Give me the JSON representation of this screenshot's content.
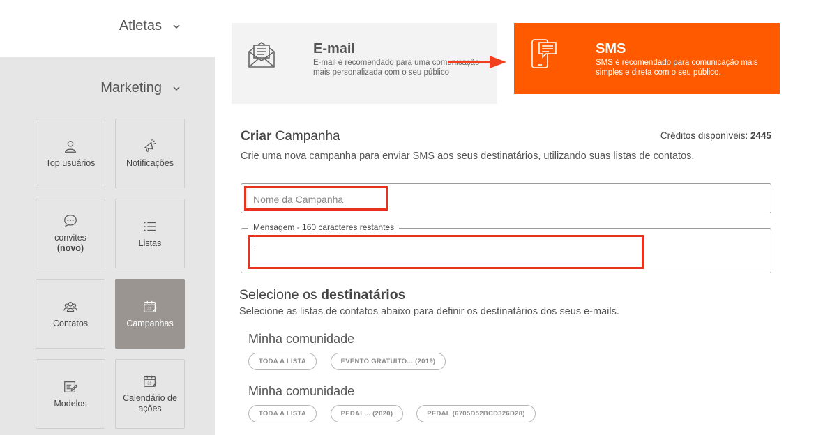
{
  "sidebar": {
    "athletes_label": "Atletas",
    "marketing_label": "Marketing",
    "tiles": {
      "top_users": "Top usuários",
      "notifications": "Notificações",
      "invites": "convites",
      "invites_badge": "(novo)",
      "lists": "Listas",
      "contacts": "Contatos",
      "campaigns": "Campanhas",
      "templates": "Modelos",
      "calendar_line1": "Calendário de",
      "calendar_line2": "ações"
    },
    "active_tile": "campaigns"
  },
  "channels": {
    "email": {
      "title": "E-mail",
      "description": "E-mail é recomendado para uma comunicação mais personalizada com o seu público"
    },
    "sms": {
      "title": "SMS",
      "description": "SMS é recomendado para comunicação mais simples e direta com o seu público."
    }
  },
  "form": {
    "title_bold": "Criar",
    "title_rest": " Campanha",
    "credits_label": "Créditos disponíveis: ",
    "credits_value": "2445",
    "subtitle": "Crie uma nova campanha para enviar SMS aos seus destinatários, utilizando suas listas de contatos.",
    "name_placeholder": "Nome da Campanha",
    "message_legend": "Mensagem - 160 caracteres restantes",
    "message_value": ""
  },
  "recipients": {
    "title_rest": "Selecione os ",
    "title_bold": "destinatários",
    "subtitle": "Selecione as listas de contatos abaixo para definir os destinatários dos seus e-mails.",
    "groups": [
      {
        "name": "Minha comunidade",
        "chips": [
          "TODA A LISTA",
          "EVENTO GRATUITO... (2019)"
        ]
      },
      {
        "name": "Minha comunidade",
        "chips": [
          "TODA A LISTA",
          "PEDAL... (2020)",
          "PEDAL (6705D52BCD326D28)"
        ]
      }
    ]
  },
  "colors": {
    "accent": "#ff5a00",
    "highlight": "#e8321e",
    "sidebar_bg": "#e6e6e6",
    "active_tile": "#9a9591"
  }
}
